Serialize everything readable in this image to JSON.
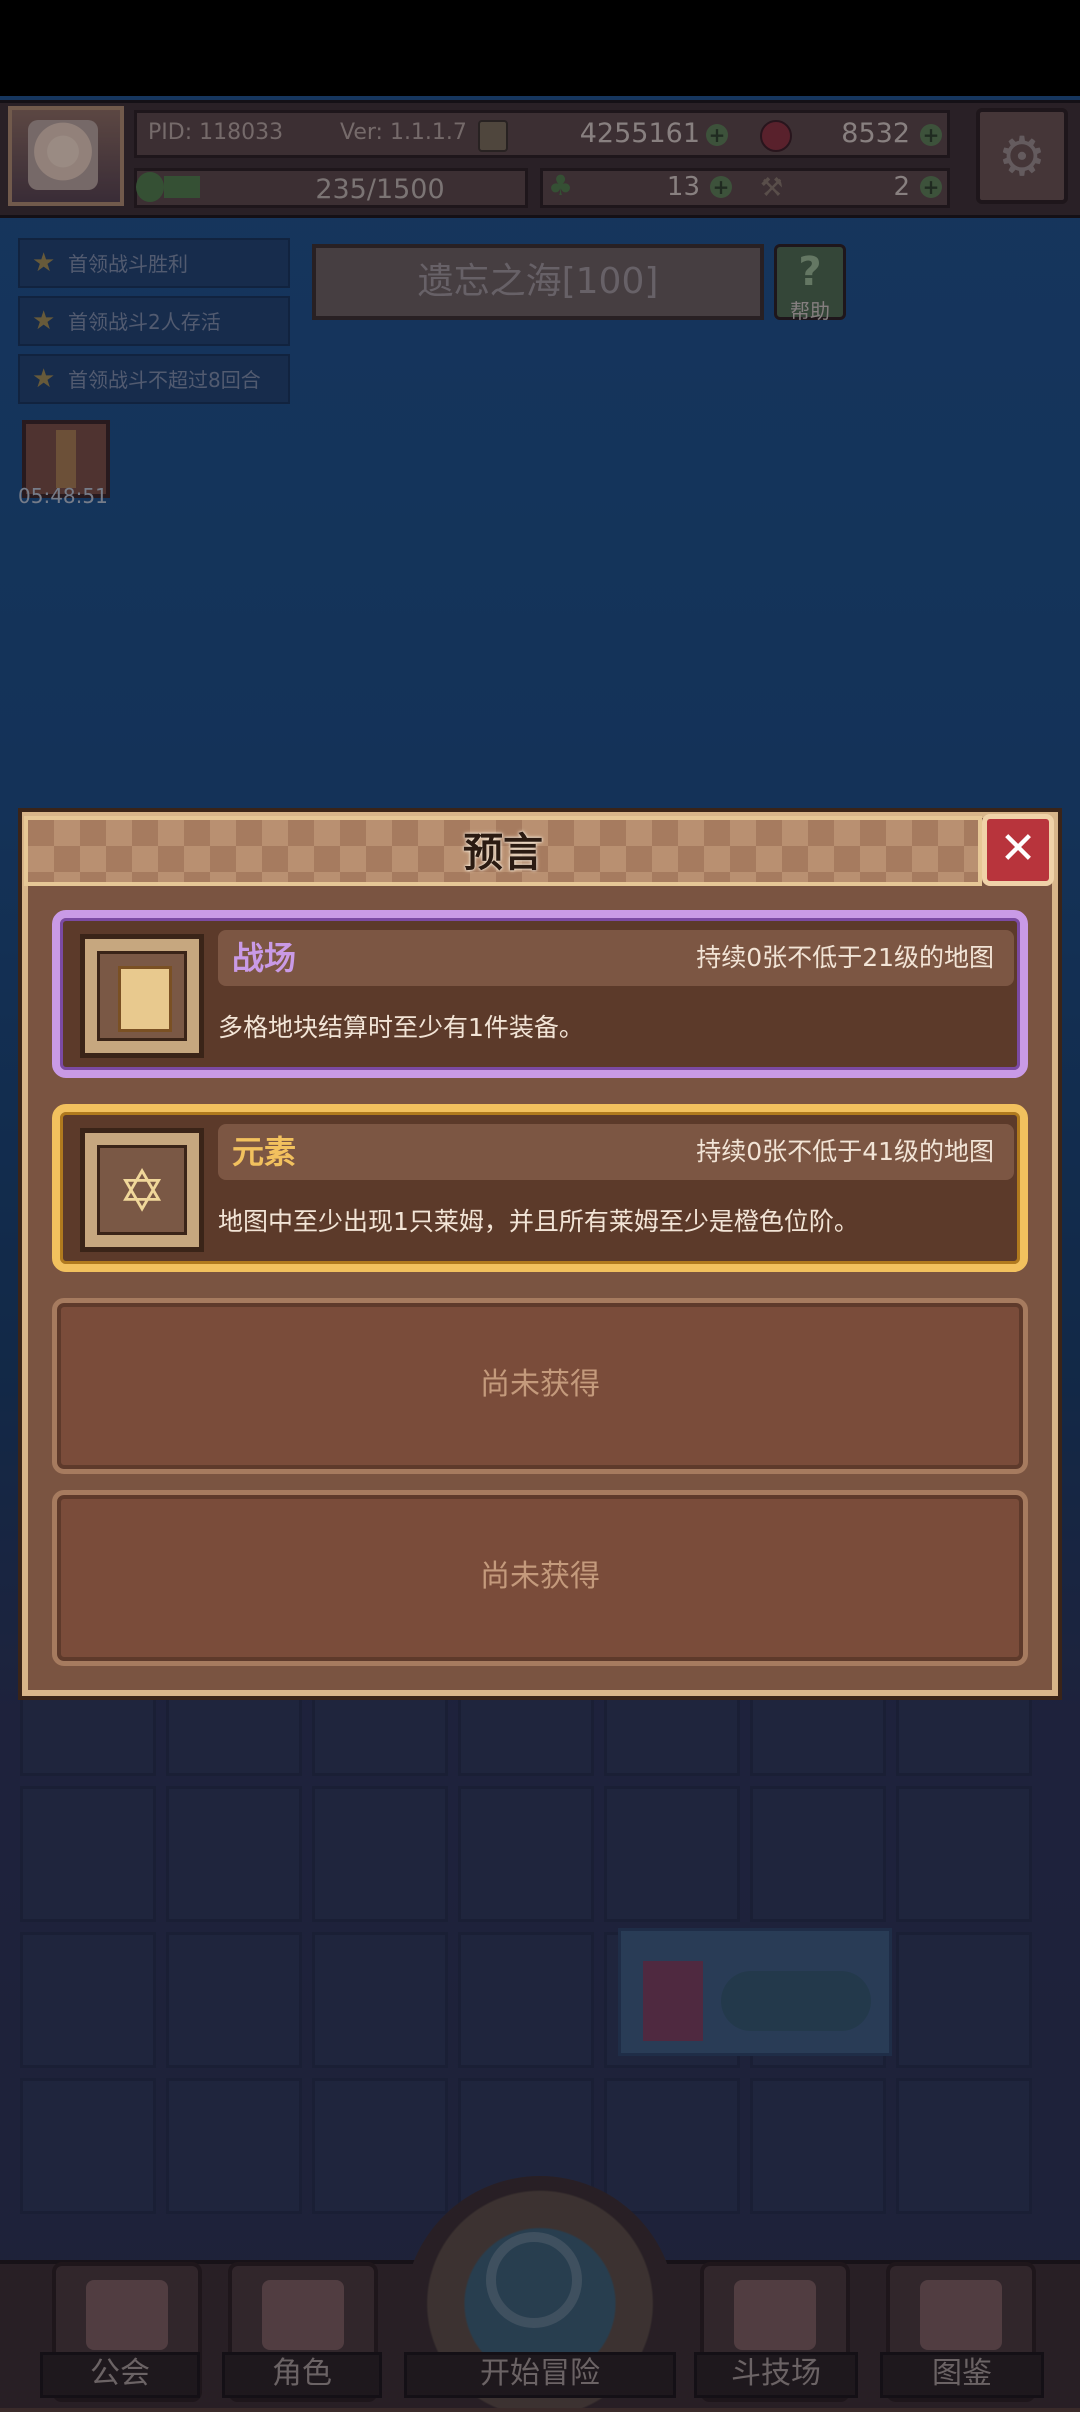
{
  "header": {
    "pid": "PID: 118033",
    "version": "Ver: 1.1.1.7",
    "gold": "4255161",
    "gems": "8532",
    "exp": "235/1500",
    "clover": "13",
    "hammer": "2"
  },
  "quests": [
    {
      "label": "首领战斗胜利"
    },
    {
      "label": "首领战斗2人存活"
    },
    {
      "label": "首领战斗不超过8回合"
    }
  ],
  "chest_timer": "05:48:51",
  "stage": {
    "title": "遗忘之海[100]",
    "help_label": "帮助",
    "help_glyph": "?"
  },
  "modal": {
    "title": "预言",
    "close_glyph": "✕",
    "prophecies": [
      {
        "name": "战场",
        "condition": "持续0张不低于21级的地图",
        "description": "多格地块结算时至少有1件装备。",
        "rarity": "purple",
        "icon": "scroll-icon"
      },
      {
        "name": "元素",
        "condition": "持续0张不低于41级的地图",
        "description": "地图中至少出现1只莱姆，并且所有莱姆至少是橙色位阶。",
        "rarity": "gold",
        "icon": "hexagram-icon"
      }
    ],
    "locked_slots": [
      {
        "label": "尚未获得"
      },
      {
        "label": "尚未获得"
      }
    ]
  },
  "nav": [
    {
      "label": "公会"
    },
    {
      "label": "角色"
    },
    {
      "label": "开始冒险"
    },
    {
      "label": "斗技场"
    },
    {
      "label": "图鉴"
    }
  ],
  "colors": {
    "purple_rarity": "#c99ae6",
    "gold_rarity": "#f2c15e",
    "modal_bg": "#7a5441",
    "close_red": "#b8343c"
  }
}
